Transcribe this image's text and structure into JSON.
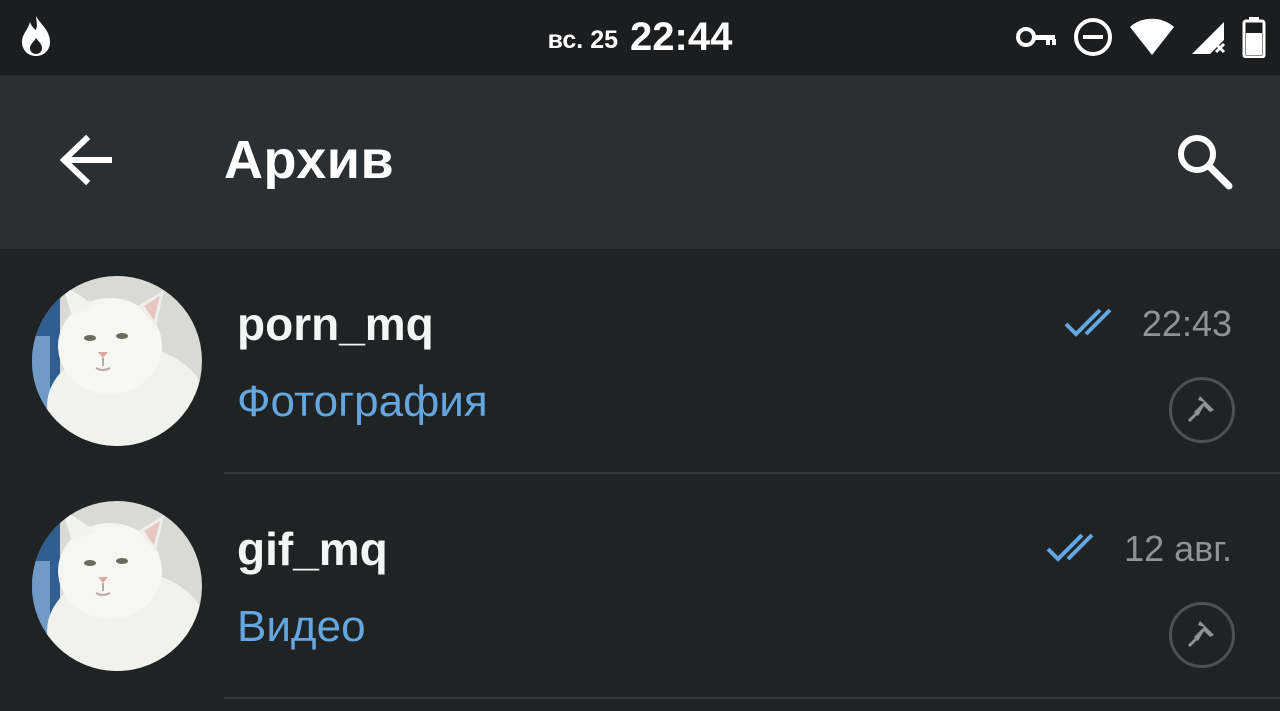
{
  "status_bar": {
    "date": "вс. 25",
    "time": "22:44",
    "left_icon": "flame-icon",
    "right_icons": [
      "vpn-key-icon",
      "do-not-disturb-icon",
      "wifi-icon",
      "signal-no-data-icon",
      "battery-icon"
    ]
  },
  "app_bar": {
    "title": "Архив",
    "back_icon": "arrow-back-icon",
    "search_icon": "search-icon"
  },
  "chats": [
    {
      "name": "porn_mq",
      "preview": "Фотография",
      "time": "22:43",
      "read_status": "double-check-icon",
      "pinned": true
    },
    {
      "name": "gif_mq",
      "preview": "Видео",
      "time": "12 авг.",
      "read_status": "double-check-icon",
      "pinned": true
    }
  ],
  "colors": {
    "background": "#202324",
    "app_bar": "#2b2f31",
    "status_bar": "#1b1d1e",
    "accent_blue": "#64a7e0",
    "time_gray": "#8e9496"
  }
}
